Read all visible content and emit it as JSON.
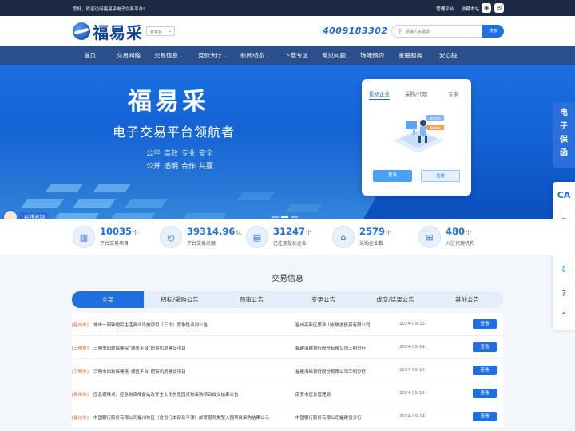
{
  "topbar": {
    "welcome": "您好，欢迎访问福易采电子交易平台!",
    "links": [
      "管理平台",
      "收藏本站"
    ]
  },
  "header": {
    "brand": "福易采",
    "platform_select": "省平台",
    "hotline": "4009183302",
    "search_placeholder": "请输入关键词",
    "search_button": "搜索"
  },
  "nav": {
    "items": [
      {
        "label": "首页",
        "dropdown": false
      },
      {
        "label": "交易网络",
        "dropdown": false
      },
      {
        "label": "交易信息",
        "dropdown": true
      },
      {
        "label": "竞价大厅",
        "dropdown": true
      },
      {
        "label": "新闻动态",
        "dropdown": true
      },
      {
        "label": "下载专区",
        "dropdown": false
      },
      {
        "label": "常见问题",
        "dropdown": false
      },
      {
        "label": "场地预约",
        "dropdown": false
      },
      {
        "label": "金融服务",
        "dropdown": false
      },
      {
        "label": "安心投",
        "dropdown": false
      }
    ]
  },
  "banner": {
    "title": "福易采",
    "subtitle": "电子交易平台领航者",
    "keywords_row1": [
      "公平",
      "高效",
      "专业",
      "安全"
    ],
    "keywords_row2": [
      "公开",
      "透明",
      "合作",
      "共赢"
    ]
  },
  "login": {
    "tabs": [
      "投标企业",
      "采购/代理",
      "专家"
    ],
    "active_tab": 0,
    "illustration_tags": [
      "投标项目",
      "数据报告"
    ],
    "login_button": "登录",
    "register_button": "注册"
  },
  "side": {
    "guarantee": "电子保函",
    "tools": [
      "CA",
      "wechat-icon",
      "service-icon",
      "download-icon",
      "help-icon",
      "top-icon"
    ]
  },
  "consult": {
    "label": "在线咨询"
  },
  "stats": [
    {
      "icon": "books-icon",
      "value": "10035",
      "unit": "个",
      "label": "平台交易项目"
    },
    {
      "icon": "coins-icon",
      "value": "39314.96",
      "unit": "亿",
      "label": "平台交易总额"
    },
    {
      "icon": "building-icon",
      "value": "31247",
      "unit": "个",
      "label": "已注册投标企业"
    },
    {
      "icon": "house-icon",
      "value": "2579",
      "unit": "个",
      "label": "采购企业数"
    },
    {
      "icon": "org-chart-icon",
      "value": "480",
      "unit": "个",
      "label": "入驻代理机构"
    }
  ],
  "trade": {
    "title": "交易信息",
    "tabs": [
      "全部",
      "招标/采购公告",
      "预审公告",
      "变更公告",
      "成交/结果公告",
      "其他公告"
    ],
    "active_tab": 0,
    "rows": [
      {
        "region": "[福州市]",
        "title": "城市一刻钟便民生活商业设施项目（三次）竞争性谈判公告",
        "org": "福州高新区旗泽山水旅游投资有限公司",
        "date": "2024-09-15",
        "action": "查看"
      },
      {
        "region": "[三明市]",
        "title": "三明市妇幼保健院“德医平台”配套机房建设项目",
        "org": "福建海峡银行股份有限公司三明分行",
        "date": "2024-09-14",
        "action": "查看"
      },
      {
        "region": "[三明市]",
        "title": "三明市妇幼保健院“德医平台”配套机房建设项目",
        "org": "福建海峡银行股份有限公司三明分行",
        "date": "2024-09-14",
        "action": "查看"
      },
      {
        "region": "[泉州市]",
        "title": "应急避难点、应急物资储备站及安全文化创意园货物采购项目成交结果公告",
        "org": "南安市应急管理局",
        "date": "2024-09-14",
        "action": "查看"
      },
      {
        "region": "[福州市]",
        "title": "中国银行股份有限公司福州地区（含省行本部及平潭）邮寄服务类型入围项目采购结果公示",
        "org": "中国银行股份有限公司福建省分行",
        "date": "2024-09-14",
        "action": "查看"
      }
    ]
  },
  "colors": {
    "primary": "#1f6fe0",
    "nav": "#2a4f8a",
    "topbar": "#1d2a44",
    "region": "#e0692a"
  }
}
